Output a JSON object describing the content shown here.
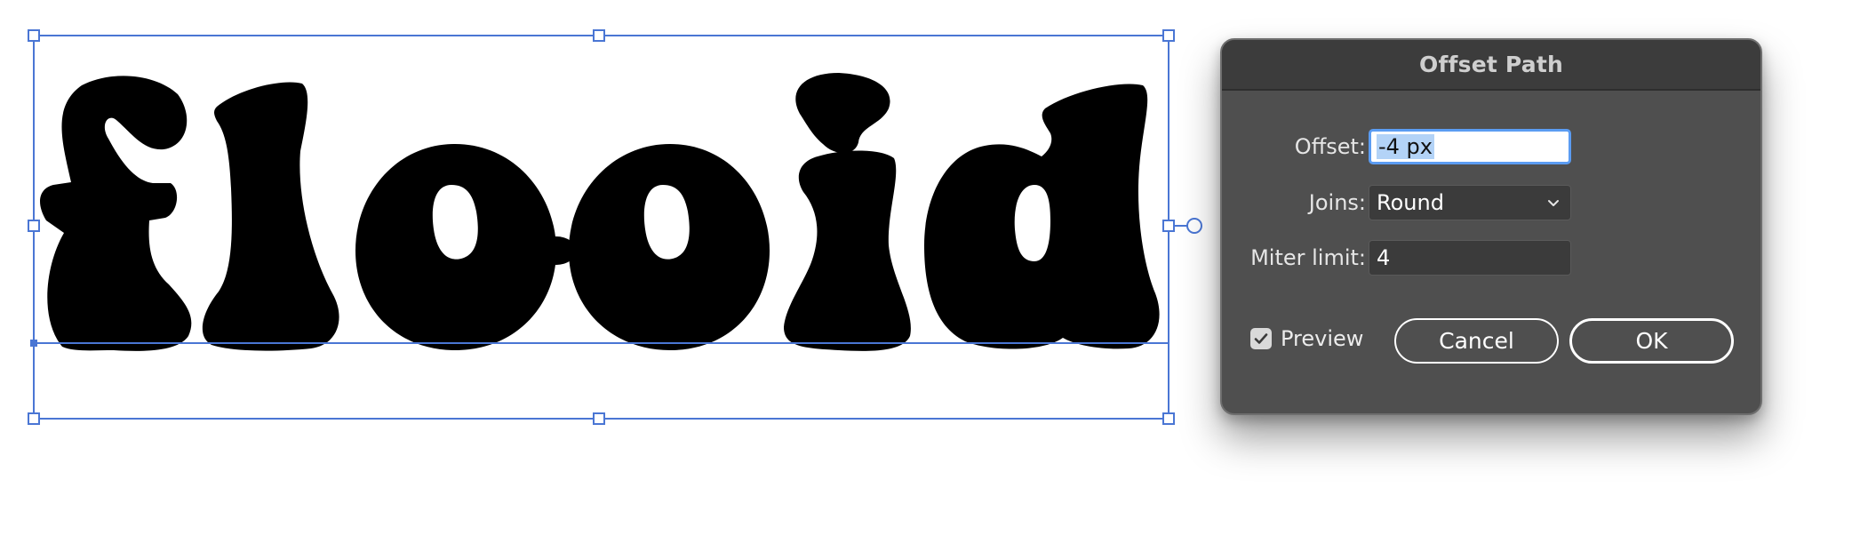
{
  "artwork": {
    "text": "flooid",
    "fill_color": "#000000",
    "selection_color": "#4a76d4"
  },
  "dialog": {
    "title": "Offset Path",
    "offset_label": "Offset:",
    "offset_value": "-4 px",
    "joins_label": "Joins:",
    "joins_value": "Round",
    "miter_label": "Miter limit:",
    "miter_value": "4",
    "preview_label": "Preview",
    "preview_checked": true,
    "cancel_label": "Cancel",
    "ok_label": "OK",
    "background_color": "#4f4f4f",
    "icons": {
      "joins_dropdown": "chevron-down-icon",
      "preview_check": "checkmark-icon"
    }
  }
}
